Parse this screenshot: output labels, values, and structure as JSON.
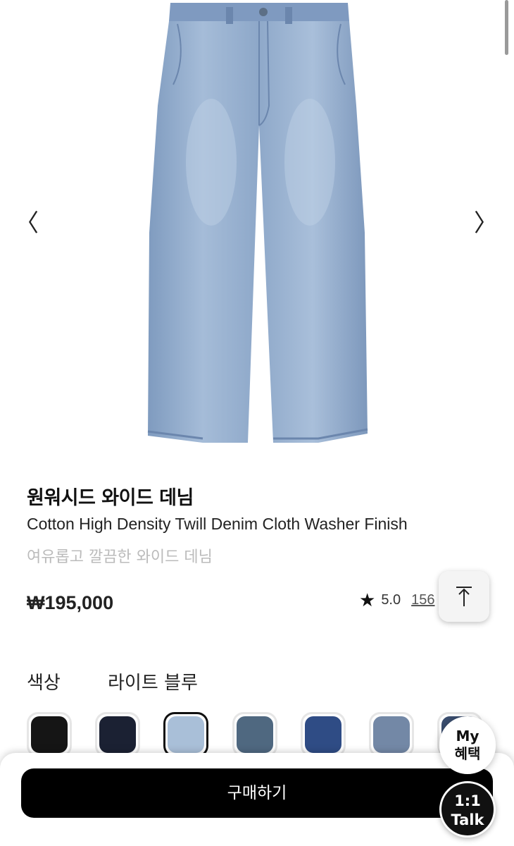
{
  "gallery": {
    "image_alt": "light blue wide denim jeans",
    "prev_icon": "〈",
    "next_icon": "〉",
    "denim_color": "#8fa9c9"
  },
  "product": {
    "name_ko": "원워시드 와이드 데님",
    "name_en": "Cotton High Density Twill Denim Cloth Washer Finish",
    "description": "여유롭고 깔끔한 와이드 데님",
    "price": "₩195,000",
    "rating": "5.0",
    "review_count": "156"
  },
  "color": {
    "label": "색상",
    "selected": "라이트 블루",
    "swatches": [
      "#151515",
      "#1b2133",
      "#a9bfd8",
      "#4f6880",
      "#2f4c85",
      "#7388a6",
      "#3a4d6e"
    ]
  },
  "actions": {
    "buy_label": "구매하기",
    "my_line1": "My",
    "my_line2": "혜택",
    "talk_line1": "1:1",
    "talk_line2": "Talk"
  }
}
